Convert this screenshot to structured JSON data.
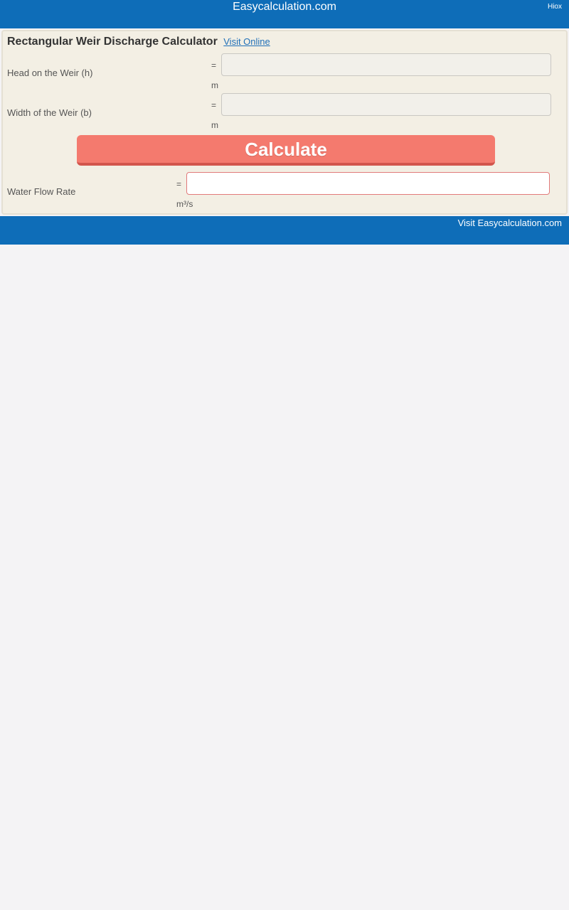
{
  "header": {
    "site_title": "Easycalculation.com",
    "right_link": "Hiox"
  },
  "calculator": {
    "title": "Rectangular Weir Discharge Calculator",
    "visit_online": "Visit Online",
    "fields": [
      {
        "label": "Head on the Weir (h)",
        "equals": "=",
        "value": "",
        "unit": "m"
      },
      {
        "label": "Width of the Weir (b)",
        "equals": "=",
        "value": "",
        "unit": "m"
      }
    ],
    "button_label": "Calculate",
    "result": {
      "label": "Water Flow Rate",
      "equals": "=",
      "value": "",
      "unit": "m³/s"
    }
  },
  "footer": {
    "link": "Visit Easycalculation.com"
  },
  "colors": {
    "header_bg": "#0e6db8",
    "panel_bg": "#f3efe4",
    "button_bg": "#f47a6e",
    "page_bg": "#f4f3f5"
  }
}
